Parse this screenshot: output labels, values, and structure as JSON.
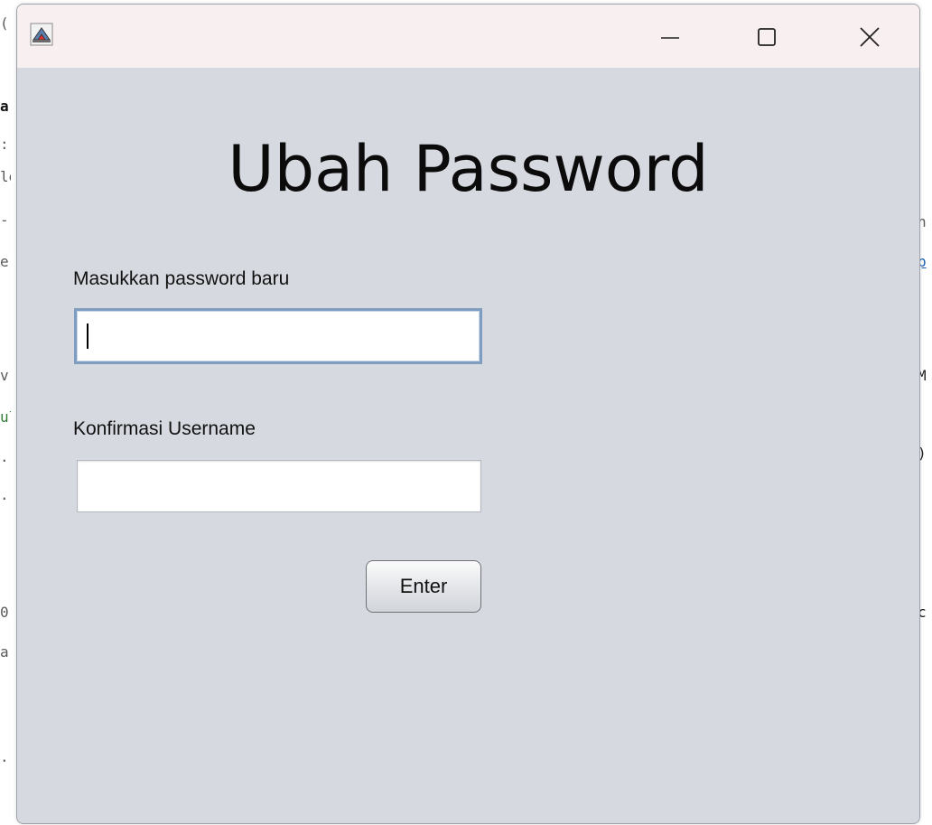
{
  "window": {
    "icon": "java-cup-icon",
    "controls": {
      "minimize": "minimize-icon",
      "maximize": "maximize-icon",
      "close": "close-icon"
    }
  },
  "form": {
    "title": "Ubah Password",
    "new_password_label": "Masukkan password baru",
    "new_password_value": "",
    "confirm_username_label": "Konfirmasi Username",
    "confirm_username_value": "",
    "enter_button_label": "Enter"
  },
  "background": {
    "left_fragments": [
      "(",
      "a.",
      ":",
      "le",
      "-",
      "e",
      "v",
      "ul",
      ".:",
      ".",
      "0",
      "a",
      "."
    ],
    "right_fragments": [
      "h",
      "p",
      "M",
      ")",
      "c"
    ]
  },
  "colors": {
    "window_bg": "#d6d9e0",
    "titlebar_bg": "#f8eff1",
    "focus_border": "#7f9dc0"
  }
}
